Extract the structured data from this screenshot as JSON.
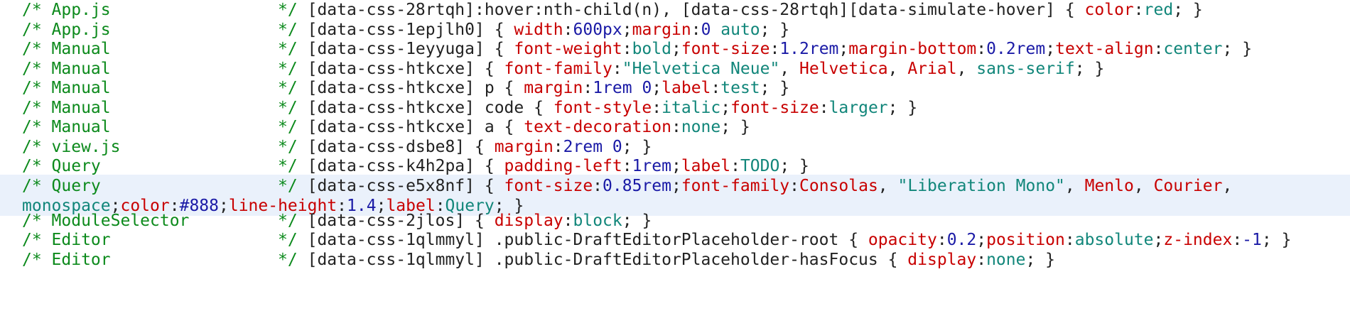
{
  "colors": {
    "comment": "#0c8a1c",
    "selector": "#222222",
    "property": "#c80000",
    "keyword": "#11867a",
    "number": "#1a1aa6",
    "string": "#11867a",
    "highlight_row": "#eaf1fb"
  },
  "rules": [
    {
      "comment": "/* App.js                 */",
      "selector": "[data-css-28rtqh]:hover:nth-child(n), [data-css-28rtqh][data-simulate-hover]",
      "decls": [
        {
          "prop": "color",
          "value": "red",
          "vclass": "kw"
        }
      ]
    },
    {
      "comment": "/* App.js                 */",
      "selector": "[data-css-1epjlh0]",
      "decls": [
        {
          "prop": "width",
          "value": "600px",
          "vclass": "nm"
        },
        {
          "prop": "margin",
          "value_parts": [
            {
              "t": "0",
              "c": "nm"
            },
            {
              "t": " auto",
              "c": "kw"
            }
          ]
        }
      ]
    },
    {
      "comment": "/* Manual                 */",
      "selector": "[data-css-1eyyuga]",
      "decls": [
        {
          "prop": "font-weight",
          "value": "bold",
          "vclass": "kw"
        },
        {
          "prop": "font-size",
          "value": "1.2rem",
          "vclass": "nm"
        },
        {
          "prop": "margin-bottom",
          "value": "0.2rem",
          "vclass": "nm"
        },
        {
          "prop": "text-align",
          "value": "center",
          "vclass": "kw"
        }
      ]
    },
    {
      "comment": "/* Manual                 */",
      "selector": "[data-css-htkcxe]",
      "decls": [
        {
          "prop": "font-family",
          "value_parts": [
            {
              "t": "\"Helvetica Neue\"",
              "c": "st"
            },
            {
              "t": ", ",
              "c": "pn"
            },
            {
              "t": "Helvetica",
              "c": "pr"
            },
            {
              "t": ", ",
              "c": "pn"
            },
            {
              "t": "Arial",
              "c": "pr"
            },
            {
              "t": ", ",
              "c": "pn"
            },
            {
              "t": "sans-serif",
              "c": "kw"
            }
          ]
        }
      ]
    },
    {
      "comment": "/* Manual                 */",
      "selector": "[data-css-htkcxe] p",
      "decls": [
        {
          "prop": "margin",
          "value_parts": [
            {
              "t": "1rem",
              "c": "nm"
            },
            {
              "t": " 0",
              "c": "nm"
            }
          ]
        },
        {
          "prop": "label",
          "value": "test",
          "vclass": "kw"
        }
      ]
    },
    {
      "comment": "/* Manual                 */",
      "selector": "[data-css-htkcxe] code",
      "decls": [
        {
          "prop": "font-style",
          "value": "italic",
          "vclass": "kw"
        },
        {
          "prop": "font-size",
          "value": "larger",
          "vclass": "kw"
        }
      ]
    },
    {
      "comment": "/* Manual                 */",
      "selector": "[data-css-htkcxe] a",
      "decls": [
        {
          "prop": "text-decoration",
          "value": "none",
          "vclass": "kw"
        }
      ]
    },
    {
      "comment": "/* view.js                */",
      "selector": "[data-css-dsbe8]",
      "decls": [
        {
          "prop": "margin",
          "value_parts": [
            {
              "t": "2rem",
              "c": "nm"
            },
            {
              "t": " 0",
              "c": "nm"
            }
          ]
        }
      ]
    },
    {
      "comment": "/* Query                  */",
      "selector": "[data-css-k4h2pa]",
      "decls": [
        {
          "prop": "padding-left",
          "value": "1rem",
          "vclass": "nm"
        },
        {
          "prop": "label",
          "value": "TODO",
          "vclass": "kw"
        }
      ]
    },
    {
      "comment": "/* Query                  */",
      "selector": "[data-css-e5x8nf]",
      "highlighted": true,
      "wrap_after_decl": 0,
      "wrap_after_part": 8,
      "decls": [
        {
          "prop": "font-size",
          "value": "0.85rem",
          "vclass": "nm"
        },
        {
          "prop": "font-family",
          "value_parts": [
            {
              "t": "Consolas",
              "c": "pr"
            },
            {
              "t": ", ",
              "c": "pn"
            },
            {
              "t": "\"Liberation Mono\"",
              "c": "st"
            },
            {
              "t": ", ",
              "c": "pn"
            },
            {
              "t": "Menlo",
              "c": "pr"
            },
            {
              "t": ", ",
              "c": "pn"
            },
            {
              "t": "Courier",
              "c": "pr"
            },
            {
              "t": ",",
              "c": "pn"
            },
            {
              "t": "monospace",
              "c": "kw"
            }
          ]
        },
        {
          "prop": "color",
          "value": "#888",
          "vclass": "nm"
        },
        {
          "prop": "line-height",
          "value": "1.4",
          "vclass": "nm"
        },
        {
          "prop": "label",
          "value": "Query",
          "vclass": "kw"
        }
      ]
    },
    {
      "comment": "/* ModuleSelector         */",
      "selector": "[data-css-2jlos]",
      "decls": [
        {
          "prop": "display",
          "value": "block",
          "vclass": "kw"
        }
      ]
    },
    {
      "comment": "/* Editor                 */",
      "selector": "[data-css-1qlmmyl] .public-DraftEditorPlaceholder-root",
      "decls": [
        {
          "prop": "opacity",
          "value": "0.2",
          "vclass": "nm"
        },
        {
          "prop": "position",
          "value": "absolute",
          "vclass": "kw"
        },
        {
          "prop": "z-index",
          "value": "-1",
          "vclass": "nm"
        }
      ]
    },
    {
      "comment": "/* Editor                 */",
      "selector": "[data-css-1qlmmyl] .public-DraftEditorPlaceholder-hasFocus",
      "decls": [
        {
          "prop": "display",
          "value": "none",
          "vclass": "kw"
        }
      ]
    }
  ]
}
